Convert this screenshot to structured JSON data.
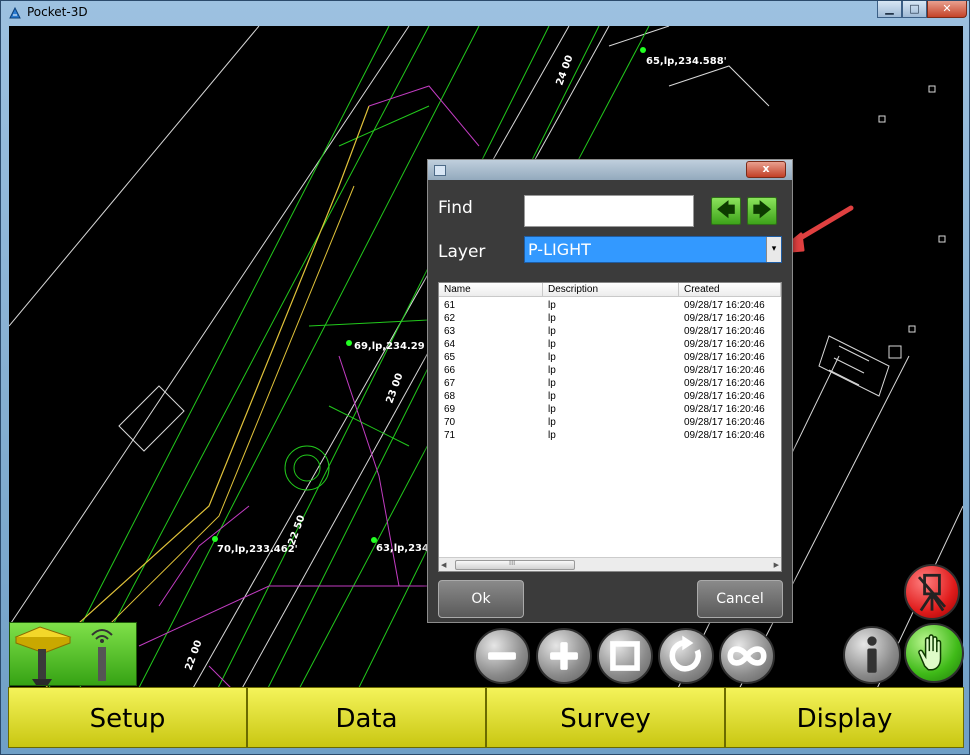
{
  "window": {
    "title": "Pocket-3D",
    "minimize": "▁",
    "maximize": "□",
    "close": "✕"
  },
  "map": {
    "labels": [
      "65,lp,234.588'",
      "69,lp,234.29",
      "70,lp,233.462'",
      "63,lp,234",
      "24 00",
      "23 00",
      "22 50",
      "22 00"
    ]
  },
  "dialog": {
    "close": "x",
    "find_label": "Find",
    "find_value": "",
    "prev_label": "🡄",
    "next_label": "🡆",
    "layer_label": "Layer",
    "layer_value": "P-LIGHT",
    "layer_dropdown": "▾",
    "columns": [
      "Name",
      "Description",
      "Created"
    ],
    "rows": [
      {
        "name": "61",
        "description": "lp",
        "created": "09/28/17 16:20:46"
      },
      {
        "name": "62",
        "description": "lp",
        "created": "09/28/17 16:20:46"
      },
      {
        "name": "63",
        "description": "lp",
        "created": "09/28/17 16:20:46"
      },
      {
        "name": "64",
        "description": "lp",
        "created": "09/28/17 16:20:46"
      },
      {
        "name": "65",
        "description": "lp",
        "created": "09/28/17 16:20:46"
      },
      {
        "name": "66",
        "description": "lp",
        "created": "09/28/17 16:20:46"
      },
      {
        "name": "67",
        "description": "lp",
        "created": "09/28/17 16:20:46"
      },
      {
        "name": "68",
        "description": "lp",
        "created": "09/28/17 16:20:46"
      },
      {
        "name": "69",
        "description": "lp",
        "created": "09/28/17 16:20:46"
      },
      {
        "name": "70",
        "description": "lp",
        "created": "09/28/17 16:20:46"
      },
      {
        "name": "71",
        "description": "lp",
        "created": "09/28/17 16:20:46"
      }
    ],
    "scroll_left": "◀",
    "scroll_right": "▶",
    "scroll_grip": "III",
    "ok_label": "Ok",
    "cancel_label": "Cancel"
  },
  "toolbar": {
    "zoom_out": "zoom-out-icon",
    "zoom_in": "zoom-in-icon",
    "zoom_extents": "zoom-extents-icon",
    "rotate": "rotate-icon",
    "orbit": "orbit-icon",
    "info": "info-icon",
    "pan": "hand-icon",
    "survey_status": "survey-disabled-icon"
  },
  "tabs": {
    "setup": "Setup",
    "data": "Data",
    "survey": "Survey",
    "display": "Display"
  },
  "colors": {
    "accent_green": "#36a314",
    "tab_yellow": "#e6e52e",
    "selection_blue": "#3399ff",
    "annotation_arrow": "#e04040"
  }
}
